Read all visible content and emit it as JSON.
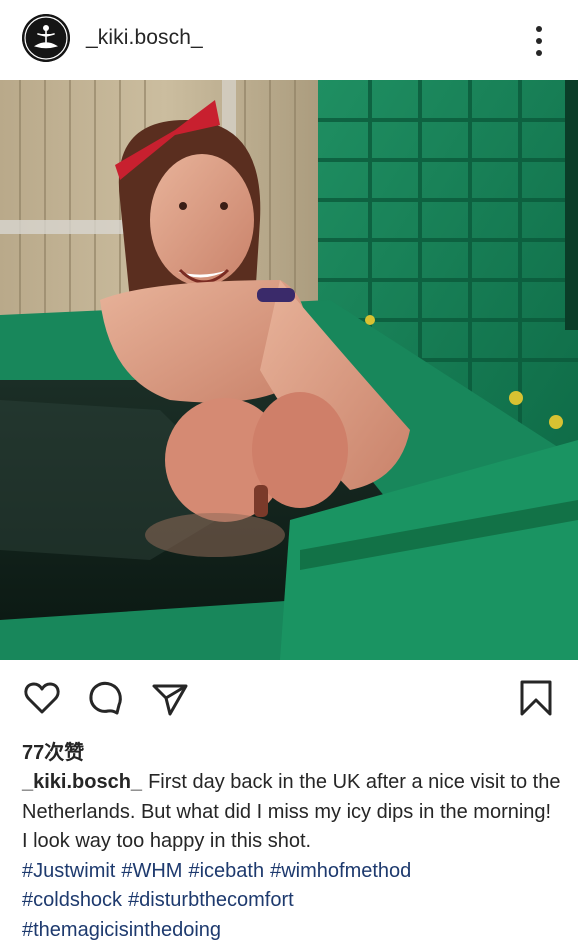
{
  "post": {
    "username": "_kiki.bosch_",
    "likes_text": "77次赞",
    "caption_text": "First day back in the UK after a nice visit to the Netherlands. But what did I miss my icy dips in the morning! I look way too happy in this shot.",
    "hashtags": [
      "#Justwimit",
      "#WHM",
      "#icebath",
      "#wimhofmethod",
      "#coldshock",
      "#disturbthecomfort",
      "#themagicisinthedoing"
    ]
  },
  "icons": {
    "avatar": "meditation-silhouette-icon",
    "more": "more-vertical-icon",
    "like": "heart-outline-icon",
    "comment": "comment-bubble-icon",
    "share": "paper-plane-icon",
    "save": "bookmark-outline-icon"
  },
  "colors": {
    "text": "#262626",
    "hashtag": "#1e3a6e",
    "tub_green": "#1e8a5e"
  }
}
